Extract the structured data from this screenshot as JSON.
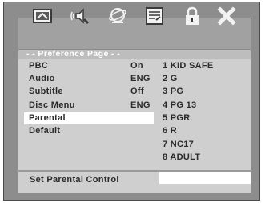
{
  "toolbar": {
    "icons": [
      "general-setup-icon",
      "audio-setup-icon",
      "dolby-digital-icon",
      "video-setup-icon",
      "preference-lock-icon",
      "exit-icon"
    ]
  },
  "header": {
    "title": "- - Preference Page - -"
  },
  "settings": [
    {
      "label": "PBC",
      "value": "On"
    },
    {
      "label": "Audio",
      "value": "ENG"
    },
    {
      "label": "Subtitle",
      "value": "Off"
    },
    {
      "label": "Disc Menu",
      "value": "ENG"
    },
    {
      "label": "Parental",
      "value": ""
    },
    {
      "label": "Default",
      "value": ""
    }
  ],
  "parental_options": [
    "1 KID SAFE",
    "2 G",
    "3 PG",
    "4 PG 13",
    "5 PGR",
    "6 R",
    "7 NC17",
    "8 ADULT"
  ],
  "selected_setting": "Parental",
  "selected_option": "8 ADULT",
  "status": {
    "text": "Set Parental Control"
  },
  "colors": {
    "panel": "#cfcfcf",
    "toolbar": "#a1a1a1",
    "frame": "#8d8d8d",
    "highlight": "#ffffff",
    "text": "#2b2b2b"
  }
}
